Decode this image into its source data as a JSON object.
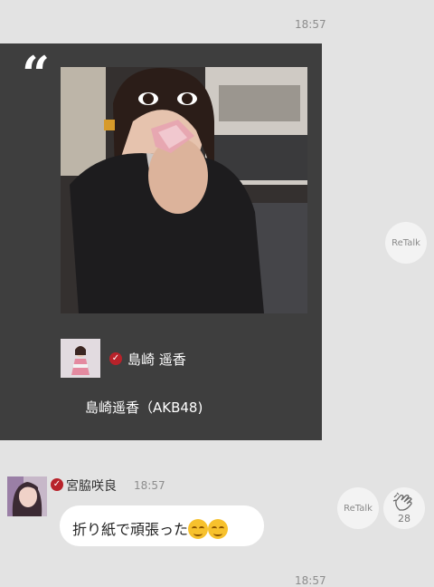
{
  "top_message": {
    "time": "18:57"
  },
  "retalk_card": {
    "author_name": "島崎 遥香",
    "caption": "島崎遥香（AKB48)",
    "retalk_label": "ReTalk",
    "image_subject": "Young woman in a dark jacket holding a pink checkered origami near her face"
  },
  "message": {
    "sender": "宮脇咲良",
    "time": "18:57",
    "text": "折り紙で頑張った",
    "emoji_icons": [
      "smiling-face-icon",
      "smiling-face-icon"
    ],
    "retalk_label": "ReTalk",
    "clap_count": "28"
  },
  "bottom_message": {
    "time": "18:57"
  },
  "colors": {
    "background": "#e3e3e3",
    "card": "#3e3e3e",
    "verified": "#b8222a",
    "bubble": "#ffffff"
  }
}
